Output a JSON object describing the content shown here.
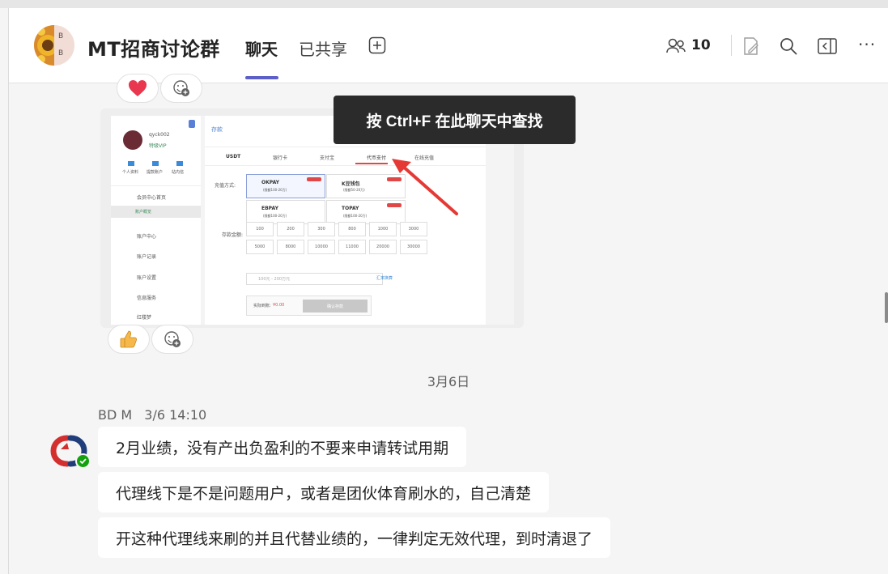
{
  "header": {
    "group_title": "MT招商讨论群",
    "avatar_letters": [
      "B",
      "B"
    ],
    "tabs": [
      {
        "label": "聊天",
        "active": true
      },
      {
        "label": "已共享",
        "active": false
      }
    ],
    "participant_count": "10",
    "icons": [
      "add-tab-icon",
      "people-icon",
      "edit-icon",
      "search-icon",
      "popout-icon",
      "more-icon"
    ]
  },
  "tooltip": {
    "text": "按 Ctrl+F 在此聊天中查找"
  },
  "reactions": {
    "top": [
      "heart-reaction",
      "add-reaction"
    ],
    "bottom": [
      "thumbs-up-reaction",
      "add-reaction"
    ]
  },
  "shared_screenshot": {
    "username": "qyck002",
    "vip": "特级VIP",
    "quick_links": [
      "个人资料",
      "提款账户",
      "站内信"
    ],
    "menu": [
      "会员中心首页",
      "账户概览",
      "账户中心",
      "账户记录",
      "账户设置",
      "信息服务",
      "红楼梦"
    ],
    "page_title": "存款",
    "pay_tabs": [
      "USDT",
      "银行卡",
      "支付宝",
      "代币支付",
      "在线充值"
    ],
    "method_label": "充值方式:",
    "methods": [
      {
        "name": "OKPAY",
        "limit": "(限额100-20万)"
      },
      {
        "name": "K豆钱包",
        "limit": "(限额50-20万)"
      },
      {
        "name": "EBPAY",
        "limit": "(限额100-20万)"
      },
      {
        "name": "TOPAY",
        "limit": "(限额100-20万)"
      }
    ],
    "amount_label": "存款金额:",
    "amounts": [
      "100",
      "200",
      "300",
      "800",
      "1000",
      "3000",
      "5000",
      "8000",
      "10000",
      "11000",
      "20000",
      "30000"
    ],
    "input_placeholder": "100元 - 200万元",
    "rate_label": "汇率换算",
    "actual_label": "实际到账:",
    "actual_value": "¥0.00",
    "submit_label": "确认存款"
  },
  "date_divider": "3月6日",
  "message": {
    "sender": "BD M",
    "time": "3/6 14:10",
    "lines": [
      "2月业绩，没有产出负盈利的不要来申请转试用期",
      "代理线下是不是问题用户，或者是团伙体育刷水的，自己清楚",
      "开这种代理线来刷的并且代替业绩的，一律判定无效代理，到时清退了"
    ]
  },
  "colors": {
    "accent": "#5b5fc7",
    "presence_available": "#13a10e",
    "tooltip_bg": "#2b2b2b",
    "pointer_arrow": "#e53935"
  }
}
